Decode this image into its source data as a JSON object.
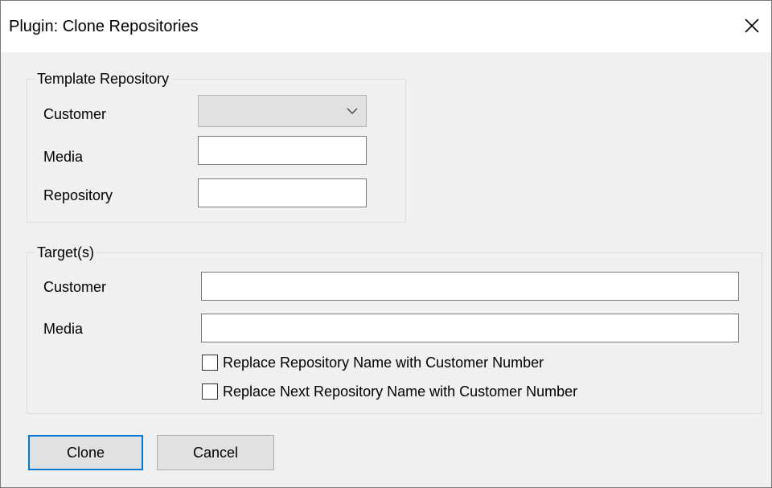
{
  "window": {
    "title": "Plugin: Clone Repositories"
  },
  "template_group": {
    "legend": "Template Repository",
    "customer_label": "Customer",
    "customer_value": "",
    "media_label": "Media",
    "media_value": "",
    "repository_label": "Repository",
    "repository_value": ""
  },
  "target_group": {
    "legend": "Target(s)",
    "customer_label": "Customer",
    "customer_value": "",
    "media_label": "Media",
    "media_value": "",
    "checkbox_replace_name_label": "Replace Repository Name with Customer Number",
    "checkbox_replace_name_checked": false,
    "checkbox_replace_next_label": "Replace Next Repository Name with Customer Number",
    "checkbox_replace_next_checked": false
  },
  "buttons": {
    "clone_label": "Clone",
    "cancel_label": "Cancel"
  },
  "colors": {
    "accent": "#0078d7",
    "window_bg": "#f0f0f0",
    "titlebar_bg": "#ffffff"
  },
  "icons": {
    "close": "close-icon",
    "dropdown": "chevron-down-icon"
  }
}
